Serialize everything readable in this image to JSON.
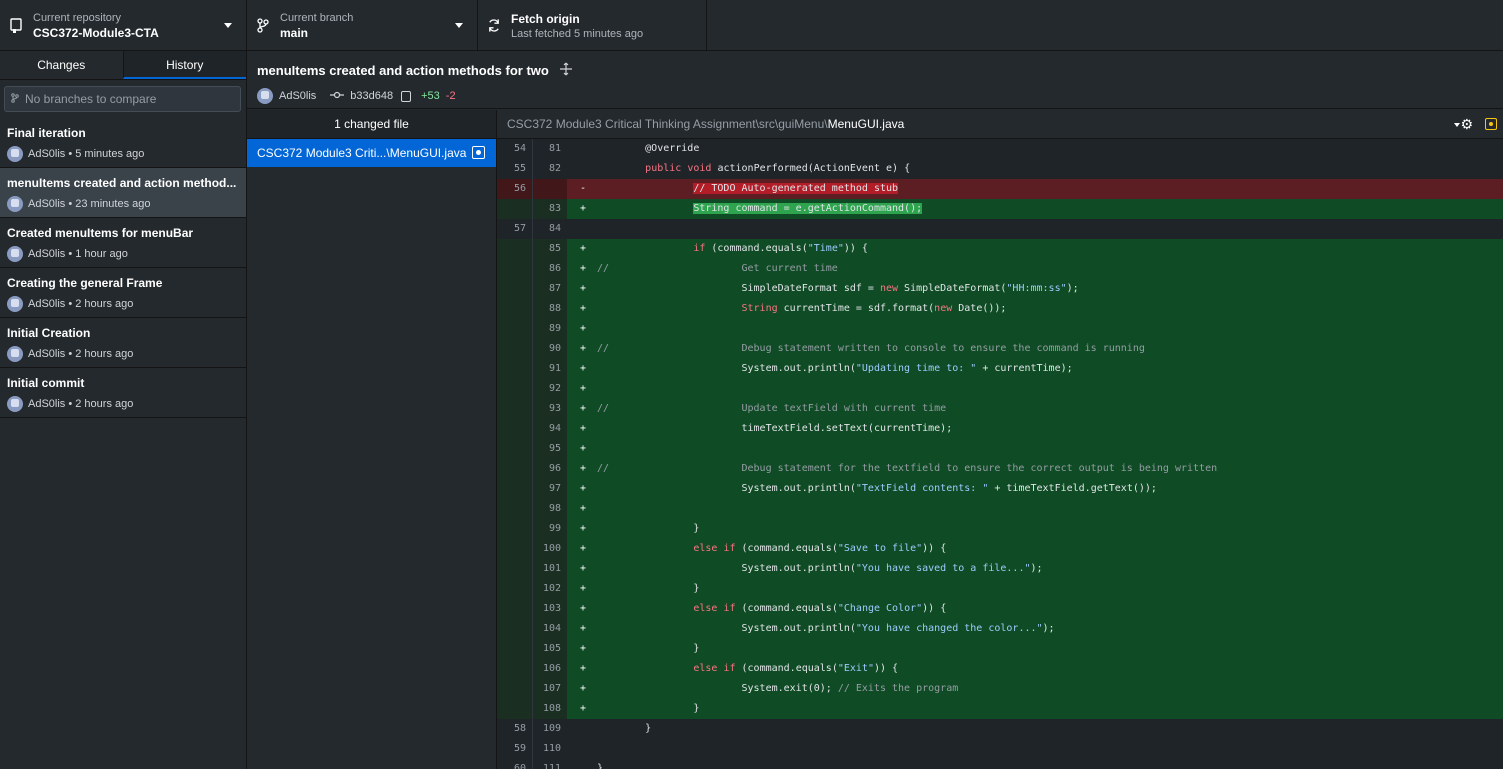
{
  "toolbar": {
    "repo_label": "Current repository",
    "repo_value": "CSC372-Module3-CTA",
    "branch_label": "Current branch",
    "branch_value": "main",
    "fetch_label": "Fetch origin",
    "fetch_sub": "Last fetched 5 minutes ago"
  },
  "sidebar": {
    "tabs": [
      "Changes",
      "History"
    ],
    "active_tab": "History",
    "compare_placeholder": "No branches to compare",
    "commits": [
      {
        "title": "Final iteration",
        "meta": "AdS0lis • 5 minutes ago"
      },
      {
        "title": "menuItems created and action method...",
        "meta": "AdS0lis • 23 minutes ago"
      },
      {
        "title": "Created menuItems for menuBar",
        "meta": "AdS0lis • 1 hour ago"
      },
      {
        "title": "Creating the general Frame",
        "meta": "AdS0lis • 2 hours ago"
      },
      {
        "title": "Initial Creation",
        "meta": "AdS0lis • 2 hours ago"
      },
      {
        "title": "Initial commit",
        "meta": "AdS0lis • 2 hours ago"
      }
    ]
  },
  "commit": {
    "title": "menuItems created and action methods for two",
    "author": "AdS0lis",
    "sha": "b33d648",
    "additions": "+53",
    "deletions": "-2"
  },
  "files": {
    "header": "1 changed file",
    "items": [
      {
        "name": "CSC372 Module3 Criti...\\MenuGUI.java"
      }
    ]
  },
  "diff": {
    "path_prefix": "CSC372 Module3 Critical Thinking Assignment\\src\\guiMenu\\",
    "file_name": "MenuGUI.java",
    "lines": [
      {
        "type": "ctx",
        "old": "54",
        "new": "81",
        "mark": "",
        "code": "        @Override"
      },
      {
        "type": "ctx",
        "old": "55",
        "new": "82",
        "mark": "",
        "code": "        public void actionPerformed(ActionEvent e) {"
      },
      {
        "type": "del",
        "old": "56",
        "new": "",
        "mark": "-",
        "code": "                // TODO Auto-generated method stub"
      },
      {
        "type": "add",
        "old": "",
        "new": "83",
        "mark": "+",
        "code": "                String command = e.getActionCommand();"
      },
      {
        "type": "ctx",
        "old": "57",
        "new": "84",
        "mark": "",
        "code": ""
      },
      {
        "type": "add",
        "old": "",
        "new": "85",
        "mark": "+",
        "code": "                if (command.equals(\"Time\")) {"
      },
      {
        "type": "add",
        "old": "",
        "new": "86",
        "mark": "+",
        "code": "//                      Get current time"
      },
      {
        "type": "add",
        "old": "",
        "new": "87",
        "mark": "+",
        "code": "                        SimpleDateFormat sdf = new SimpleDateFormat(\"HH:mm:ss\");"
      },
      {
        "type": "add",
        "old": "",
        "new": "88",
        "mark": "+",
        "code": "                        String currentTime = sdf.format(new Date());"
      },
      {
        "type": "add",
        "old": "",
        "new": "89",
        "mark": "+",
        "code": ""
      },
      {
        "type": "add",
        "old": "",
        "new": "90",
        "mark": "+",
        "code": "//                      Debug statement written to console to ensure the command is running"
      },
      {
        "type": "add",
        "old": "",
        "new": "91",
        "mark": "+",
        "code": "                        System.out.println(\"Updating time to: \" + currentTime);"
      },
      {
        "type": "add",
        "old": "",
        "new": "92",
        "mark": "+",
        "code": ""
      },
      {
        "type": "add",
        "old": "",
        "new": "93",
        "mark": "+",
        "code": "//                      Update textField with current time"
      },
      {
        "type": "add",
        "old": "",
        "new": "94",
        "mark": "+",
        "code": "                        timeTextField.setText(currentTime);"
      },
      {
        "type": "add",
        "old": "",
        "new": "95",
        "mark": "+",
        "code": ""
      },
      {
        "type": "add",
        "old": "",
        "new": "96",
        "mark": "+",
        "code": "//                      Debug statement for the textfield to ensure the correct output is being written"
      },
      {
        "type": "add",
        "old": "",
        "new": "97",
        "mark": "+",
        "code": "                        System.out.println(\"TextField contents: \" + timeTextField.getText());"
      },
      {
        "type": "add",
        "old": "",
        "new": "98",
        "mark": "+",
        "code": ""
      },
      {
        "type": "add",
        "old": "",
        "new": "99",
        "mark": "+",
        "code": "                }"
      },
      {
        "type": "add",
        "old": "",
        "new": "100",
        "mark": "+",
        "code": "                else if (command.equals(\"Save to file\")) {"
      },
      {
        "type": "add",
        "old": "",
        "new": "101",
        "mark": "+",
        "code": "                        System.out.println(\"You have saved to a file...\");"
      },
      {
        "type": "add",
        "old": "",
        "new": "102",
        "mark": "+",
        "code": "                }"
      },
      {
        "type": "add",
        "old": "",
        "new": "103",
        "mark": "+",
        "code": "                else if (command.equals(\"Change Color\")) {"
      },
      {
        "type": "add",
        "old": "",
        "new": "104",
        "mark": "+",
        "code": "                        System.out.println(\"You have changed the color...\");"
      },
      {
        "type": "add",
        "old": "",
        "new": "105",
        "mark": "+",
        "code": "                }"
      },
      {
        "type": "add",
        "old": "",
        "new": "106",
        "mark": "+",
        "code": "                else if (command.equals(\"Exit\")) {"
      },
      {
        "type": "add",
        "old": "",
        "new": "107",
        "mark": "+",
        "code": "                        System.exit(0); // Exits the program"
      },
      {
        "type": "add",
        "old": "",
        "new": "108",
        "mark": "+",
        "code": "                }"
      },
      {
        "type": "ctx",
        "old": "58",
        "new": "109",
        "mark": "",
        "code": "        }"
      },
      {
        "type": "ctx",
        "old": "59",
        "new": "110",
        "mark": "",
        "code": ""
      },
      {
        "type": "ctx",
        "old": "60",
        "new": "111",
        "mark": "",
        "code": "}"
      }
    ]
  },
  "colors": {
    "accent": "#0366d6",
    "added_bg": "#0f4b24",
    "deleted_bg": "#5c1e22",
    "additions_text": "#85e89d",
    "deletions_text": "#f97583"
  }
}
